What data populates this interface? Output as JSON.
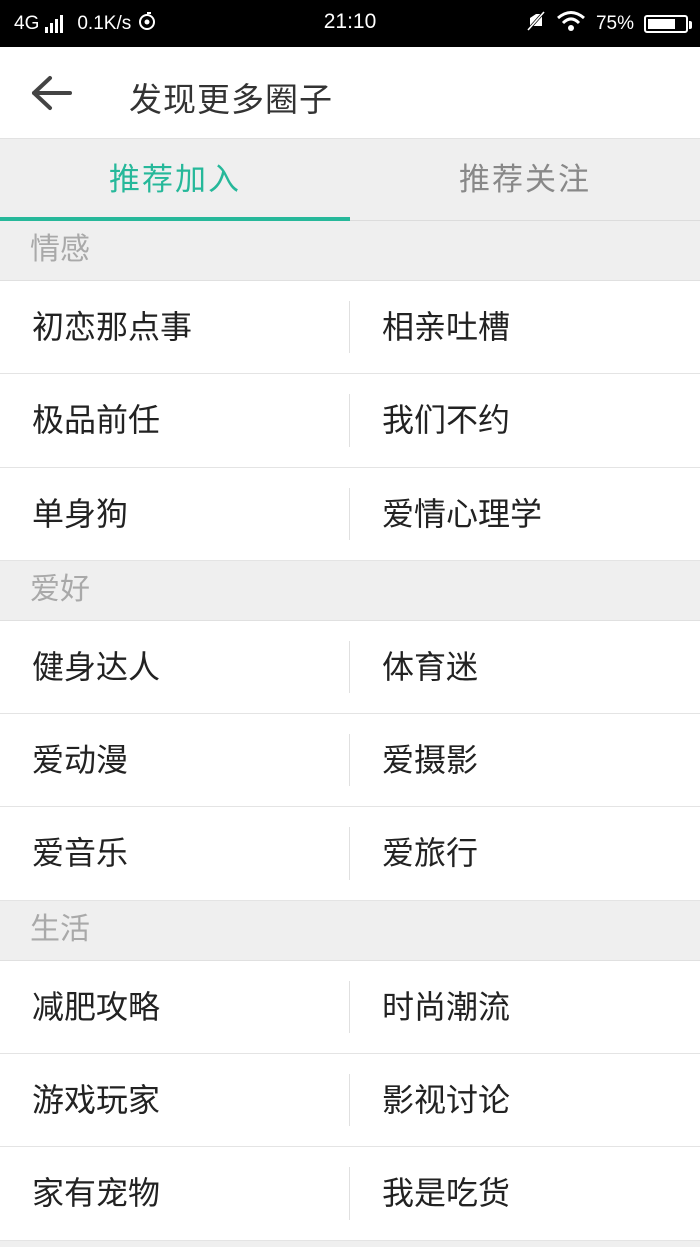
{
  "status_bar": {
    "network": "4G",
    "speed": "0.1K/s",
    "time": "21:10",
    "battery": "75%",
    "battery_level": 0.75
  },
  "header": {
    "title": "发现更多圈子"
  },
  "tabs": [
    {
      "label": "推荐加入",
      "active": true
    },
    {
      "label": "推荐关注",
      "active": false
    }
  ],
  "sections": [
    {
      "title": "情感",
      "rows": [
        [
          "初恋那点事",
          "相亲吐槽"
        ],
        [
          "极品前任",
          "我们不约"
        ],
        [
          "单身狗",
          "爱情心理学"
        ]
      ]
    },
    {
      "title": "爱好",
      "rows": [
        [
          "健身达人",
          "体育迷"
        ],
        [
          "爱动漫",
          "爱摄影"
        ],
        [
          "爱音乐",
          "爱旅行"
        ]
      ]
    },
    {
      "title": "生活",
      "rows": [
        [
          "减肥攻略",
          "时尚潮流"
        ],
        [
          "游戏玩家",
          "影视讨论"
        ],
        [
          "家有宠物",
          "我是吃货"
        ]
      ]
    }
  ],
  "colors": {
    "accent": "#26b89a",
    "section_bg": "#efefef"
  }
}
